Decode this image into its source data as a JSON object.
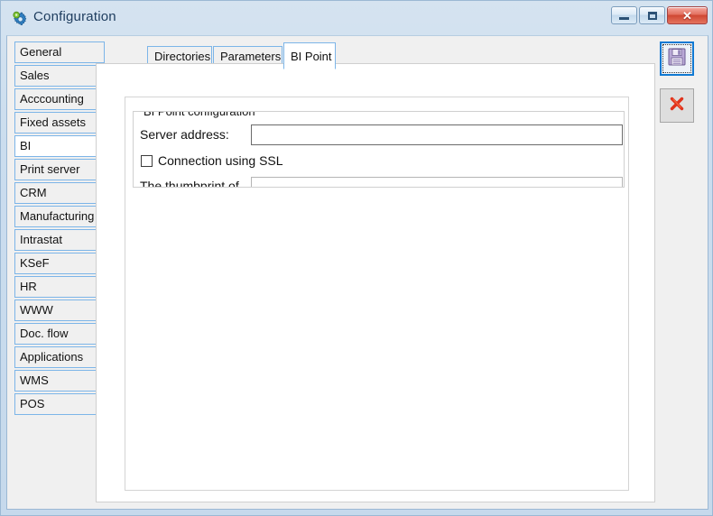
{
  "window": {
    "title": "Configuration",
    "icon": "gear-icon",
    "controls": {
      "minimize_label": "–",
      "maximize_label": "□",
      "close_label": "✕"
    }
  },
  "sidebar": {
    "selected": "BI",
    "items": [
      {
        "label": "General"
      },
      {
        "label": "Sales"
      },
      {
        "label": "Acccounting"
      },
      {
        "label": "Fixed assets"
      },
      {
        "label": "BI"
      },
      {
        "label": "Print server"
      },
      {
        "label": "CRM"
      },
      {
        "label": "Manufacturing"
      },
      {
        "label": "Intrastat"
      },
      {
        "label": "KSeF"
      },
      {
        "label": "HR"
      },
      {
        "label": "WWW"
      },
      {
        "label": "Doc. flow"
      },
      {
        "label": "Applications"
      },
      {
        "label": "WMS"
      },
      {
        "label": "POS"
      }
    ]
  },
  "tabs": {
    "active": "BI Point",
    "items": [
      {
        "label": "Directories"
      },
      {
        "label": "Parameters"
      },
      {
        "label": "BI Point"
      }
    ]
  },
  "form": {
    "group_title": "BI Point configuration",
    "server_address": {
      "label": "Server address:",
      "value": "",
      "placeholder": ""
    },
    "ssl": {
      "label": "Connection using SSL",
      "checked": false
    },
    "thumbprint": {
      "label": "The thumbprint of",
      "value": "",
      "placeholder": ""
    }
  },
  "toolbar": {
    "save_title": "Save",
    "save_icon": "floppy-disk-icon",
    "cancel_title": "Cancel",
    "cancel_icon": "red-x-icon"
  },
  "colors": {
    "accent_border": "#7cb5e8",
    "title_text": "#1d3c5e",
    "frame": "#c3d8ec",
    "close_red": "#cf4632",
    "focus_blue": "#1079d2"
  }
}
